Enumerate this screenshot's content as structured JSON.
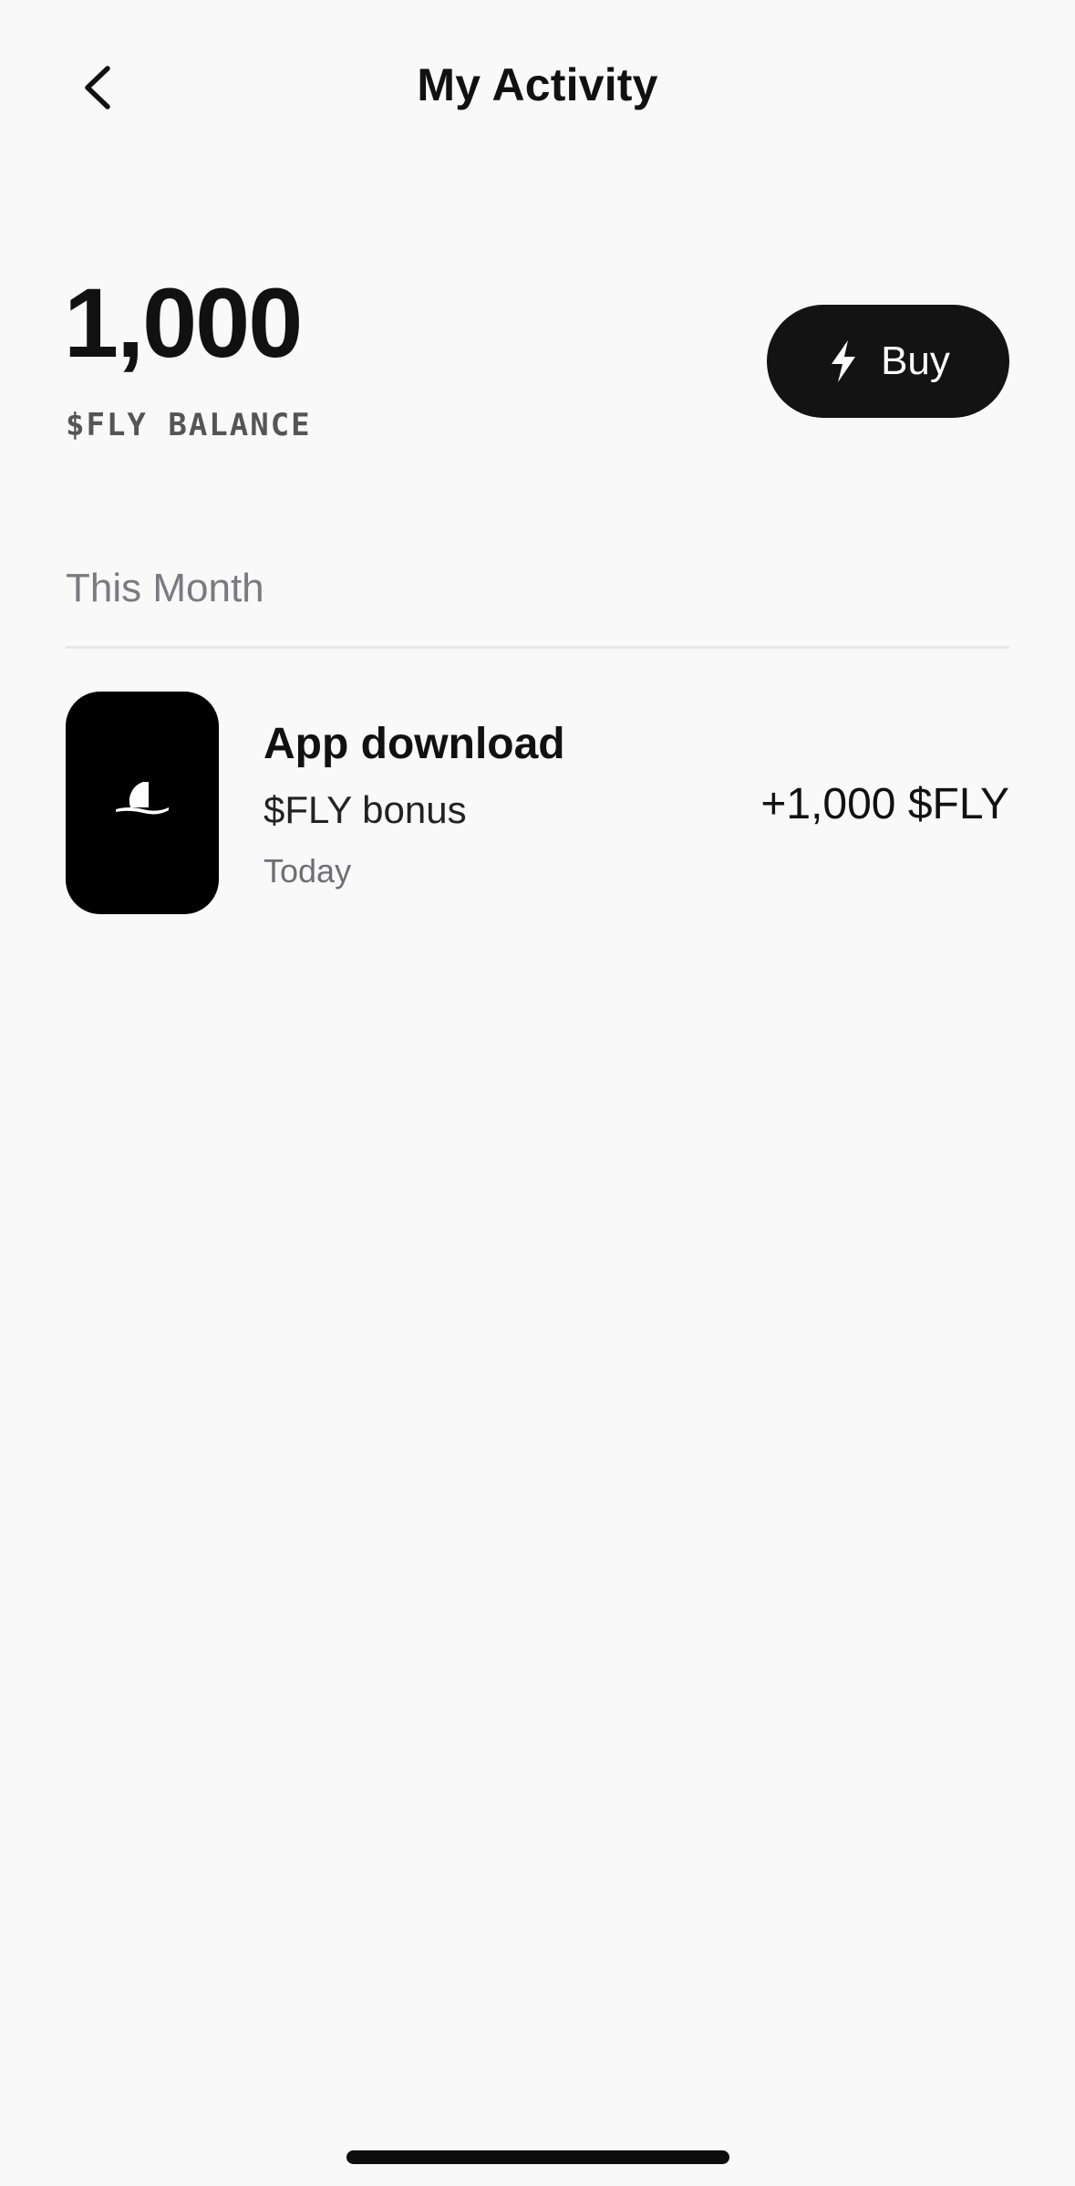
{
  "header": {
    "back_icon": "chevron-left-icon",
    "title": "My Activity"
  },
  "balance": {
    "amount": "1,000",
    "label": "$FLY BALANCE"
  },
  "buy_button": {
    "icon": "lightning-bolt-icon",
    "label": "Buy"
  },
  "activity": {
    "section_title": "This Month",
    "items": [
      {
        "icon": "app-logo-icon",
        "title": "App download",
        "subtitle": "$FLY bonus",
        "date": "Today",
        "amount": "+1,000 $FLY"
      }
    ]
  },
  "colors": {
    "background": "#f9f9f9",
    "button_bg": "#131313",
    "muted_text": "#7a7a80",
    "divider": "#e7e7e9"
  }
}
